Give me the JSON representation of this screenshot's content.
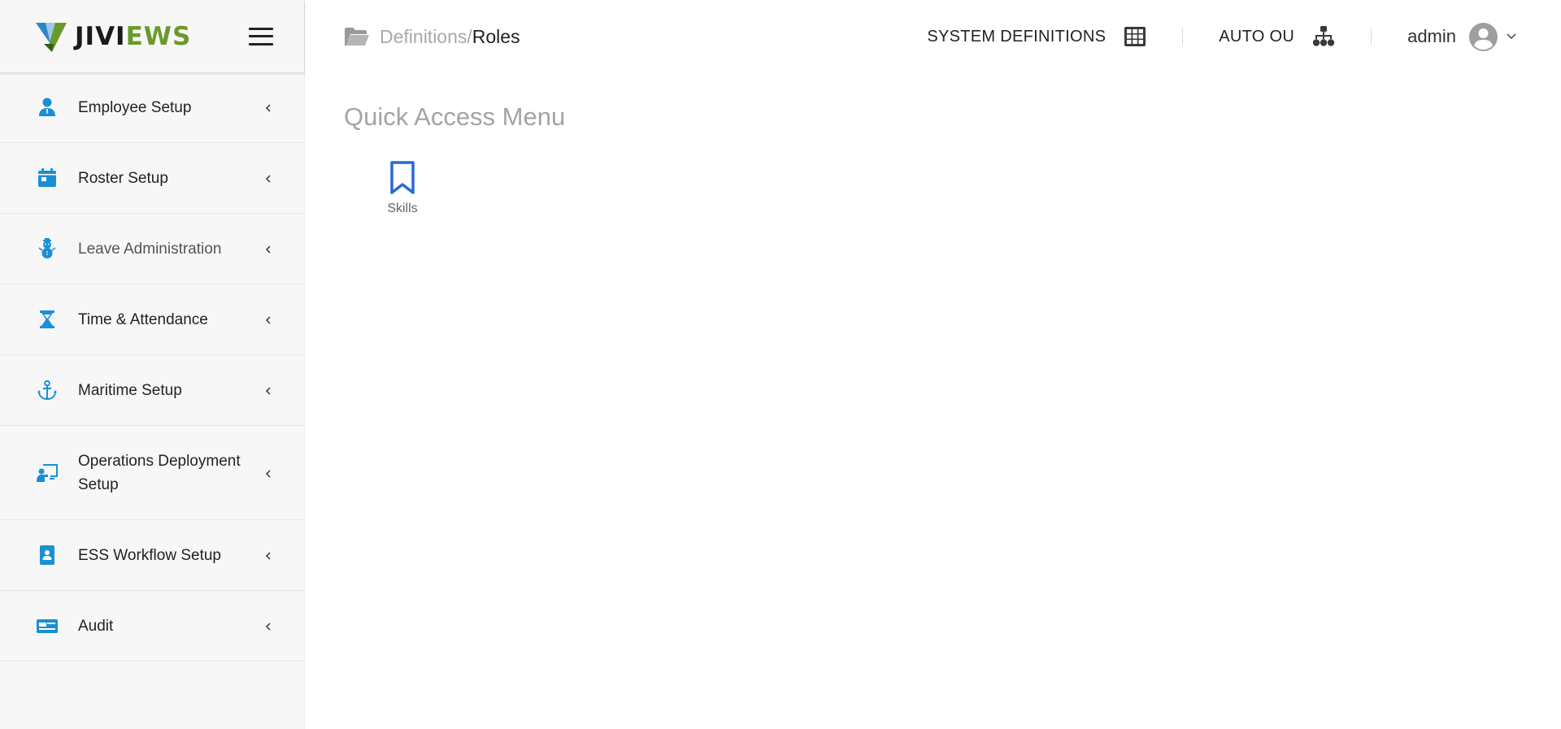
{
  "brand": {
    "logo_part1": "JIVI",
    "logo_part2": "EWS"
  },
  "sidebar": {
    "items": [
      {
        "label": "Employee Setup",
        "icon": "user-icon"
      },
      {
        "label": "Roster Setup",
        "icon": "calendar-icon"
      },
      {
        "label": "Leave Administration",
        "icon": "snowman-icon"
      },
      {
        "label": "Time & Attendance",
        "icon": "hourglass-icon"
      },
      {
        "label": "Maritime Setup",
        "icon": "anchor-icon"
      },
      {
        "label": "Operations Deployment Setup",
        "icon": "presentation-icon"
      },
      {
        "label": "ESS Workflow Setup",
        "icon": "contact-card-icon"
      },
      {
        "label": "Audit",
        "icon": "id-card-icon"
      }
    ]
  },
  "header": {
    "breadcrumb_parent": "Definitions/",
    "breadcrumb_current": "Roles",
    "system_definitions": "SYSTEM DEFINITIONS",
    "auto_ou": "AUTO OU",
    "user_name": "admin"
  },
  "main": {
    "title": "Quick Access Menu",
    "tiles": [
      {
        "label": "Skills",
        "icon": "bookmark-icon"
      }
    ]
  },
  "colors": {
    "accent_blue": "#1a8fd6",
    "brand_green": "#6a9a2c",
    "tile_blue": "#2a6ad0"
  }
}
